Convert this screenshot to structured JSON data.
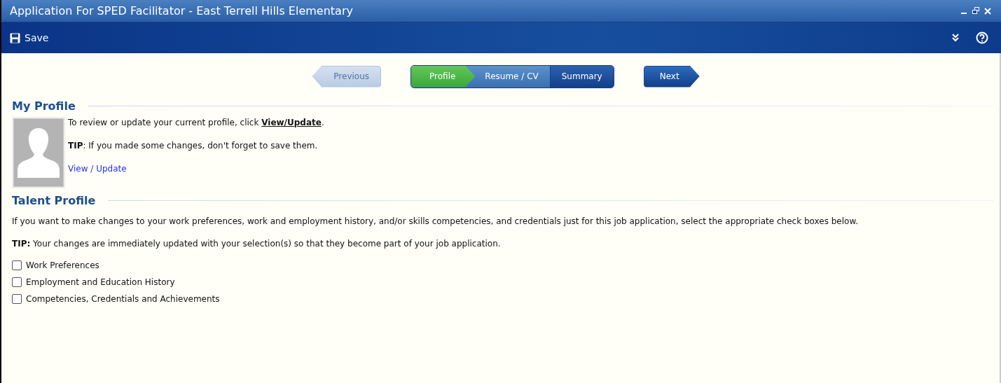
{
  "window": {
    "title": "Application For SPED Facilitator - East Terrell Hills Elementary"
  },
  "toolbar": {
    "save": "Save"
  },
  "wizard": {
    "previous": {
      "label": "Previous",
      "disabled": true
    },
    "steps": [
      {
        "label": "Profile",
        "selected": true
      },
      {
        "label": "Resume / CV",
        "selected": false
      },
      {
        "label": "Summary",
        "selected": false
      }
    ],
    "next": {
      "label": "Next",
      "disabled": false
    }
  },
  "my_profile": {
    "heading": "My Profile",
    "intro": "To review or update your current profile, click ",
    "intro_link": "View/Update",
    "intro_end": ".",
    "tip": "**TIP**:  If you made some changes, don't forget to save them.",
    "link": "View / Update"
  },
  "talent_profile": {
    "heading": "Talent Profile",
    "description": "If you want to make changes to your work preferences, work and employment history, and/or skills competencies, and credentials just for this job application, select the appropriate check boxes below.",
    "tip": "**TIP:**  Your changes are immediately updated with your selection(s) so that they become part of your job application.",
    "options": [
      {
        "label": "Work Preferences",
        "checked": false
      },
      {
        "label": "Employment and Education History",
        "checked": false
      },
      {
        "label": "Competencies, Credentials and Achievements",
        "checked": false
      }
    ]
  }
}
